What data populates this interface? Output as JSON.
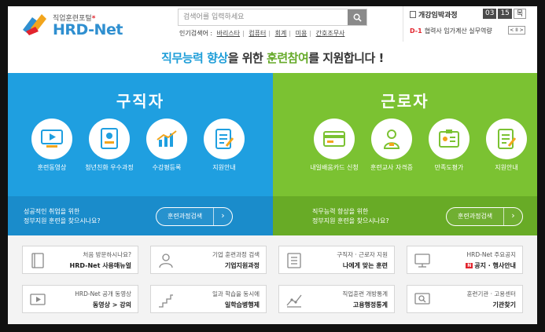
{
  "header": {
    "logo_sub": "직업훈련포털",
    "logo_main": "HRD-Net",
    "search": {
      "placeholder": "검색어를 입력하세요"
    },
    "popular_label": "인기검색어 :",
    "popular_keywords": [
      "바리스타",
      "컴퓨터",
      "회계",
      "미용",
      "간호조무사"
    ]
  },
  "course_panel": {
    "title": "개강임박과정",
    "date_month": "03",
    "date_day": "15",
    "date_weekday": "목",
    "dday": "D-1",
    "line": "협력사 임가계산 실무역량",
    "controls": "< II >"
  },
  "tagline": {
    "part1": "직무능력 향상",
    "part2": "을 위한 ",
    "part3": "훈련참여",
    "part4": "를 지원합니다 !"
  },
  "seeker": {
    "title": "구직자",
    "items": [
      {
        "label": "훈련동영상",
        "icon": "video-icon"
      },
      {
        "label": "청년친화 우수과정",
        "icon": "certificate-icon"
      },
      {
        "label": "수강평등록",
        "icon": "chart-icon"
      },
      {
        "label": "지원안내",
        "icon": "document-icon"
      }
    ],
    "bottom_line1": "성공적인 취업을 위한",
    "bottom_line2": "정부지원 훈련을 찾으시나요?",
    "button_label": "훈련과정검색"
  },
  "worker": {
    "title": "근로자",
    "items": [
      {
        "label": "내일배움카드 신청",
        "icon": "card-icon"
      },
      {
        "label": "훈련교사 자격증",
        "icon": "teacher-icon"
      },
      {
        "label": "만족도평가",
        "icon": "id-badge-icon"
      },
      {
        "label": "지원안내",
        "icon": "document-icon"
      }
    ],
    "bottom_line1": "직무능력 향상을 위한",
    "bottom_line2": "정부지원 훈련을 찾으시나요?",
    "button_label": "훈련과정검색"
  },
  "tiles": [
    {
      "sub": "처음 방문하시나요?",
      "main": "HRD-Net 사용매뉴얼",
      "icon": "book-icon"
    },
    {
      "sub": "기업 훈련과정 검색",
      "main": "기업지원과정",
      "icon": "person-icon"
    },
    {
      "sub": "구직자 · 근로자 지원",
      "main": "나에게 맞는 훈련",
      "icon": "checklist-icon"
    },
    {
      "sub": "HRD-Net 주요공지",
      "main": "공지 · 행사안내",
      "badge": "N",
      "icon": "monitor-icon"
    },
    {
      "sub": "HRD-Net 공개 동영상",
      "main": "동영상 > 강의",
      "icon": "play-icon"
    },
    {
      "sub": "일과 학습을 동시에",
      "main": "일학습병행제",
      "icon": "stairs-icon"
    },
    {
      "sub": "직업훈련 개방통계",
      "main": "고용행정통계",
      "icon": "stats-icon"
    },
    {
      "sub": "훈련기관 · 고용센터",
      "main": "기관찾기",
      "icon": "search-map-icon"
    }
  ],
  "colors": {
    "seeker": "#1f9fe0",
    "worker": "#7bc232",
    "accent_red": "#e2242d"
  }
}
